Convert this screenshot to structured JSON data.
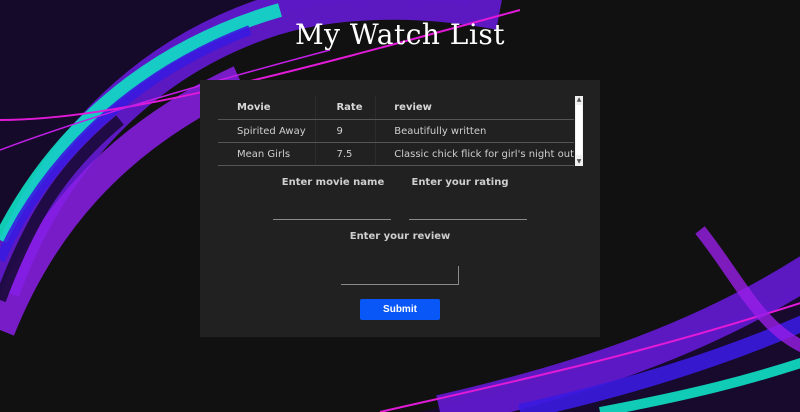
{
  "page": {
    "title": "My Watch List"
  },
  "table": {
    "headers": [
      "Movie",
      "Rate",
      "review"
    ],
    "rows": [
      [
        "Spirited Away",
        "9",
        "Beautifully written"
      ],
      [
        "Mean Girls",
        "7.5",
        "Classic chick flick for girl's night out"
      ]
    ]
  },
  "form": {
    "movie_label": "Enter movie name",
    "rating_label": "Enter your rating",
    "review_label": "Enter your review",
    "movie_value": "",
    "rating_value": "",
    "review_value": "",
    "submit_label": "Submit"
  },
  "colors": {
    "background": "#111111",
    "panel": "#212121",
    "submit": "#0a57f7",
    "swirl_teal": "#10e0c4",
    "swirl_purple": "#6a1be0",
    "swirl_magenta": "#e01ad6"
  }
}
